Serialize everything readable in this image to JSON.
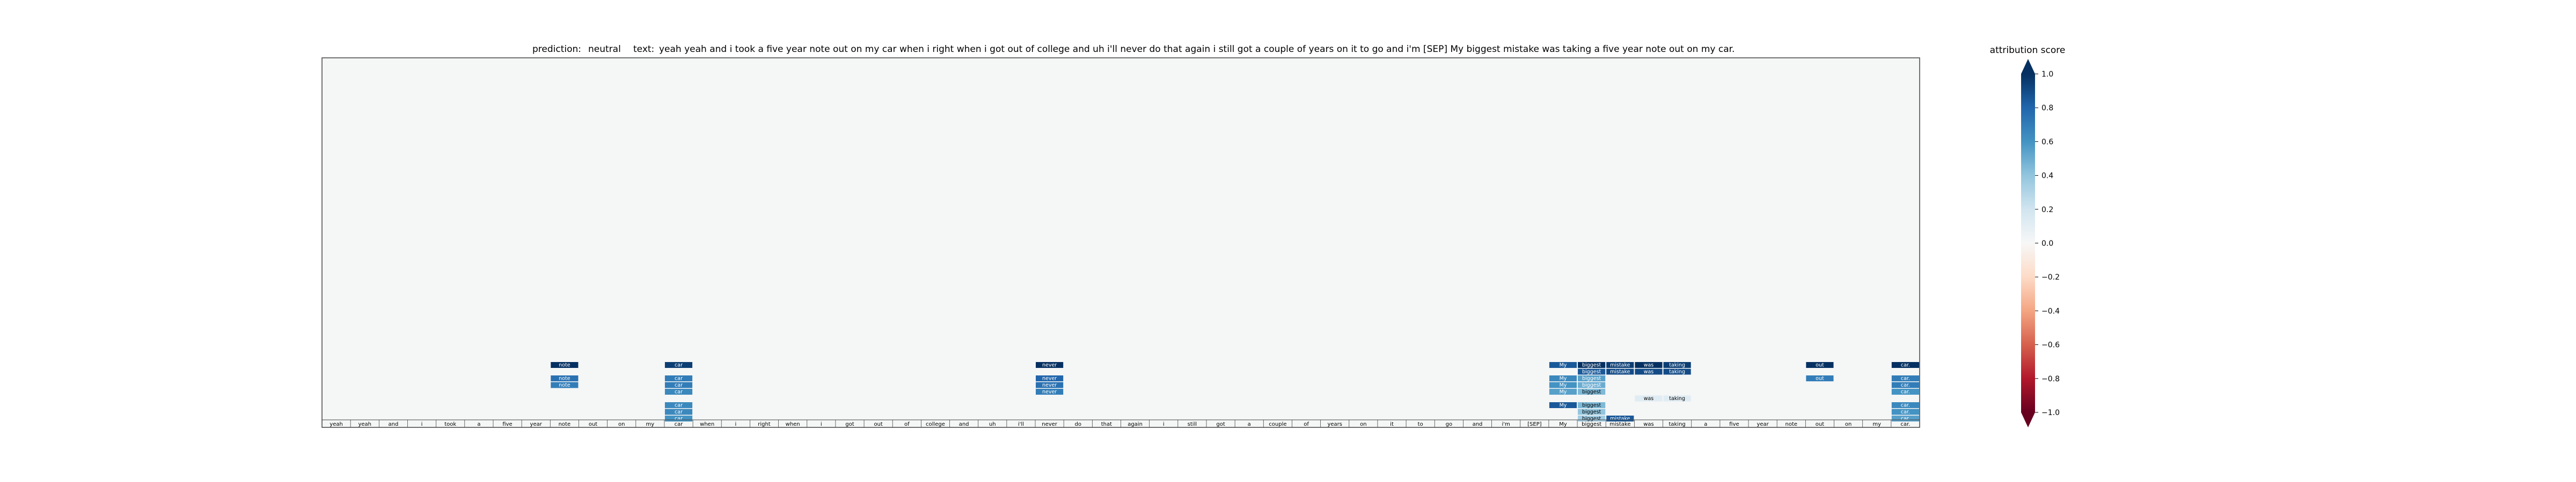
{
  "header": {
    "prediction_label": "prediction:",
    "prediction_value": "neutral",
    "text_label": "text:",
    "text_value": "yeah yeah and i took a five year note out on my car when i right when i got out of college and uh i'll never do that again i still got a couple of years on it to go and i'm [SEP] My biggest mistake was taking a five year note out on my car."
  },
  "colorbar": {
    "title": "attribution score",
    "ticks": [
      1.0,
      0.8,
      0.6,
      0.4,
      0.2,
      0.0,
      -0.2,
      -0.4,
      -0.6,
      -0.8,
      -1.0
    ],
    "tick_labels": [
      "1.0",
      "0.8",
      "0.6",
      "0.4",
      "0.2",
      "0.0",
      "−0.2",
      "−0.4",
      "−0.6",
      "−0.8",
      "−1.0"
    ],
    "colors": [
      "#67001f",
      "#b2182b",
      "#d6604d",
      "#f4a582",
      "#fddbc7",
      "#f7f7f7",
      "#d1e5f0",
      "#92c5de",
      "#4393c3",
      "#2166ac",
      "#053061"
    ],
    "background_color": "#f5f6f6"
  },
  "chart_data": {
    "type": "heatmap",
    "title": "",
    "xlabel": "",
    "ylabel": "",
    "value_range": [
      -1.0,
      1.0
    ],
    "tokens": [
      "yeah",
      "yeah",
      "and",
      "i",
      "took",
      "a",
      "five",
      "year",
      "note",
      "out",
      "on",
      "my",
      "car",
      "when",
      "i",
      "right",
      "when",
      "i",
      "got",
      "out",
      "of",
      "college",
      "and",
      "uh",
      "i'll",
      "never",
      "do",
      "that",
      "again",
      "i",
      "still",
      "got",
      "a",
      "couple",
      "of",
      "years",
      "on",
      "it",
      "to",
      "go",
      "and",
      "i'm",
      "[SEP]",
      "My",
      "biggest",
      "mistake",
      "was",
      "taking",
      "a",
      "five",
      "year",
      "note",
      "out",
      "on",
      "my",
      "car."
    ],
    "attribution_rows": [
      {
        "token_index": 8,
        "values": [
          1.0,
          0.0,
          0.75,
          0.7,
          0.0,
          0.0,
          0.0,
          0.0,
          0.0
        ]
      },
      {
        "token_index": 12,
        "values": [
          0.95,
          0.0,
          0.7,
          0.7,
          0.65,
          0.0,
          0.65,
          0.65,
          0.6
        ]
      },
      {
        "token_index": 25,
        "values": [
          1.0,
          0.0,
          0.8,
          0.75,
          0.7,
          0.0,
          0.0,
          0.0,
          0.0
        ]
      },
      {
        "token_index": 43,
        "values": [
          0.85,
          0.0,
          0.65,
          0.6,
          0.55,
          0.0,
          0.85,
          0.0,
          0.0
        ]
      },
      {
        "token_index": 44,
        "values": [
          1.0,
          0.85,
          0.55,
          0.5,
          0.45,
          0.0,
          0.45,
          0.4,
          0.35
        ]
      },
      {
        "token_index": 45,
        "values": [
          0.95,
          0.9,
          0.0,
          0.0,
          0.0,
          0.0,
          0.0,
          0.0,
          0.85
        ]
      },
      {
        "token_index": 46,
        "values": [
          1.0,
          0.9,
          0.0,
          0.0,
          0.0,
          0.12,
          0.0,
          0.0,
          0.0
        ]
      },
      {
        "token_index": 47,
        "values": [
          0.95,
          0.9,
          0.0,
          0.0,
          0.0,
          0.12,
          0.0,
          0.0,
          0.0
        ]
      },
      {
        "token_index": 52,
        "values": [
          1.0,
          0.0,
          0.7,
          0.0,
          0.0,
          0.0,
          0.0,
          0.0,
          0.0
        ]
      },
      {
        "token_index": 55,
        "values": [
          1.0,
          0.0,
          0.7,
          0.7,
          0.6,
          0.0,
          0.65,
          0.6,
          0.55
        ]
      }
    ]
  }
}
